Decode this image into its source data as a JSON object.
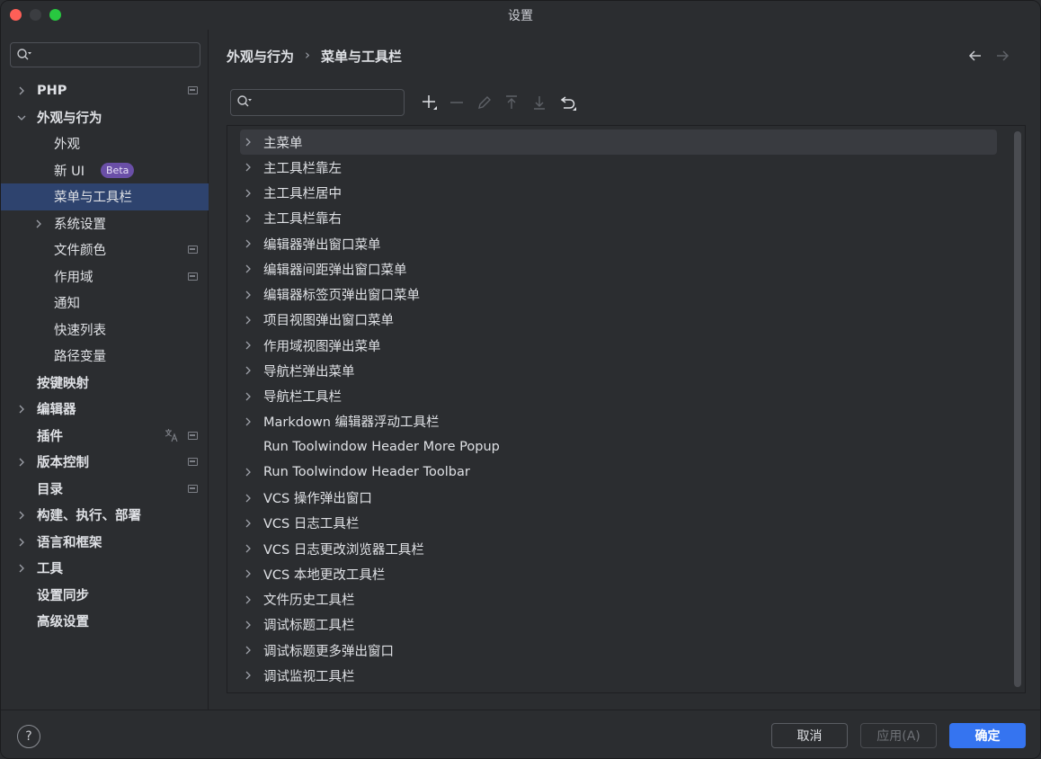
{
  "window": {
    "title": "设置"
  },
  "sidebar": {
    "search_placeholder": "",
    "items": [
      {
        "label": "PHP",
        "chevron": "right",
        "level": 0,
        "bold": true,
        "marker": true
      },
      {
        "label": "外观与行为",
        "chevron": "down",
        "level": 0,
        "bold": true
      },
      {
        "label": "外观",
        "level": 1
      },
      {
        "label": "新 UI",
        "level": 1,
        "badge": "Beta"
      },
      {
        "label": "菜单与工具栏",
        "level": 1,
        "selected": true
      },
      {
        "label": "系统设置",
        "chevron": "right",
        "level": 1
      },
      {
        "label": "文件颜色",
        "level": 1,
        "marker": true
      },
      {
        "label": "作用域",
        "level": 1,
        "marker": true
      },
      {
        "label": "通知",
        "level": 1
      },
      {
        "label": "快速列表",
        "level": 1
      },
      {
        "label": "路径变量",
        "level": 1
      },
      {
        "label": "按键映射",
        "level": 0,
        "bold": true
      },
      {
        "label": "编辑器",
        "chevron": "right",
        "level": 0,
        "bold": true
      },
      {
        "label": "插件",
        "level": 0,
        "bold": true,
        "marker": true,
        "translate_icon": true
      },
      {
        "label": "版本控制",
        "chevron": "right",
        "level": 0,
        "bold": true,
        "marker": true
      },
      {
        "label": "目录",
        "level": 0,
        "bold": true,
        "marker": true
      },
      {
        "label": "构建、执行、部署",
        "chevron": "right",
        "level": 0,
        "bold": true
      },
      {
        "label": "语言和框架",
        "chevron": "right",
        "level": 0,
        "bold": true
      },
      {
        "label": "工具",
        "chevron": "right",
        "level": 0,
        "bold": true
      },
      {
        "label": "设置同步",
        "level": 0,
        "bold": true
      },
      {
        "label": "高级设置",
        "level": 0,
        "bold": true
      }
    ]
  },
  "breadcrumb": {
    "parent": "外观与行为",
    "separator": "›",
    "current": "菜单与工具栏"
  },
  "toolbar": {
    "search_placeholder": "",
    "icons": [
      "add-icon",
      "remove-icon",
      "edit-icon",
      "move-up-icon",
      "move-down-icon",
      "restore-icon"
    ]
  },
  "tree": {
    "rows": [
      {
        "label": "主菜单",
        "chevron": true,
        "selected": true
      },
      {
        "label": "主工具栏靠左",
        "chevron": true
      },
      {
        "label": "主工具栏居中",
        "chevron": true
      },
      {
        "label": "主工具栏靠右",
        "chevron": true
      },
      {
        "label": "编辑器弹出窗口菜单",
        "chevron": true
      },
      {
        "label": "编辑器间距弹出窗口菜单",
        "chevron": true
      },
      {
        "label": "编辑器标签页弹出窗口菜单",
        "chevron": true
      },
      {
        "label": "项目视图弹出窗口菜单",
        "chevron": true
      },
      {
        "label": "作用域视图弹出菜单",
        "chevron": true
      },
      {
        "label": "导航栏弹出菜单",
        "chevron": true
      },
      {
        "label": "导航栏工具栏",
        "chevron": true
      },
      {
        "label": "Markdown 编辑器浮动工具栏",
        "chevron": true
      },
      {
        "label": "Run Toolwindow Header More Popup",
        "chevron": false
      },
      {
        "label": "Run Toolwindow Header Toolbar",
        "chevron": true
      },
      {
        "label": "VCS 操作弹出窗口",
        "chevron": true
      },
      {
        "label": "VCS 日志工具栏",
        "chevron": true
      },
      {
        "label": "VCS 日志更改浏览器工具栏",
        "chevron": true
      },
      {
        "label": "VCS 本地更改工具栏",
        "chevron": true
      },
      {
        "label": "文件历史工具栏",
        "chevron": true
      },
      {
        "label": "调试标题工具栏",
        "chevron": true
      },
      {
        "label": "调试标题更多弹出窗口",
        "chevron": true
      },
      {
        "label": "调试监视工具栏",
        "chevron": true
      }
    ]
  },
  "footer": {
    "help_label": "?",
    "cancel_label": "取消",
    "apply_label": "应用(A)",
    "ok_label": "确定"
  },
  "colors": {
    "background": "#2b2d30",
    "selection_sidebar": "#2e436e",
    "selection_row": "#393b40",
    "accent_button": "#3574f0",
    "beta_badge": "#6a4fa7"
  }
}
